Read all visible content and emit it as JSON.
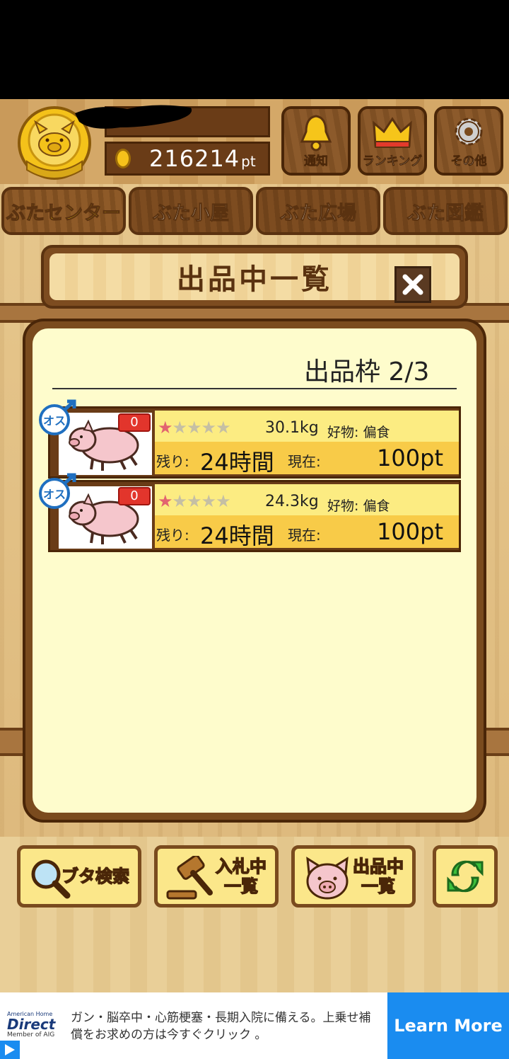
{
  "header": {
    "points_value": "216214",
    "points_unit": "pt",
    "buttons": [
      {
        "label": "通知",
        "icon": "bell-icon"
      },
      {
        "label": "ランキング",
        "icon": "crown-icon"
      },
      {
        "label": "その他",
        "icon": "gear-icon"
      }
    ]
  },
  "tabs": [
    {
      "label": "ぶたセンター",
      "active": true
    },
    {
      "label": "ぶた小屋",
      "active": false
    },
    {
      "label": "ぶた広場",
      "active": false
    },
    {
      "label": "ぶた図鑑",
      "active": false
    }
  ],
  "dialog": {
    "title": "出品中一覧",
    "slots_label": "出品枠 2/3",
    "listings": [
      {
        "sex_label": "オス",
        "bids": "0",
        "stars": "★★★★★",
        "rating": 1,
        "weight": "30.1kg",
        "fav_label": "好物:",
        "fav_value": "偏食",
        "remain_label": "残り:",
        "remain_value": "24時間",
        "now_label": "現在:",
        "price": "100pt"
      },
      {
        "sex_label": "オス",
        "bids": "0",
        "stars": "★★★★★",
        "rating": 1,
        "weight": "24.3kg",
        "fav_label": "好物:",
        "fav_value": "偏食",
        "remain_label": "残り:",
        "remain_value": "24時間",
        "now_label": "現在:",
        "price": "100pt"
      }
    ]
  },
  "bottom_buttons": [
    {
      "label": "ブタ検索",
      "icon": "magnifier-icon"
    },
    {
      "label_line1": "入札中",
      "label_line2": "一覧",
      "icon": "gavel-icon"
    },
    {
      "label_line1": "出品中",
      "label_line2": "一覧",
      "icon": "pig-face-icon"
    },
    {
      "label": "",
      "icon": "refresh-icon"
    }
  ],
  "ad": {
    "brand_line1": "American Home",
    "brand_line2": "Direct",
    "brand_line3": "Member of AIG",
    "text": "ガン・脳卒中・心筋梗塞・長期入院に備える。上乗せ補償をお求めの方は今すぐクリック 。",
    "cta": "Learn More"
  },
  "colors": {
    "wood_dark": "#5a3210",
    "panel_cream": "#fefccc",
    "tab_active_text": "#ffd21a",
    "ad_blue": "#1a8cf0",
    "bid_badge_red": "#e2352c",
    "star_pink": "#e26470"
  }
}
